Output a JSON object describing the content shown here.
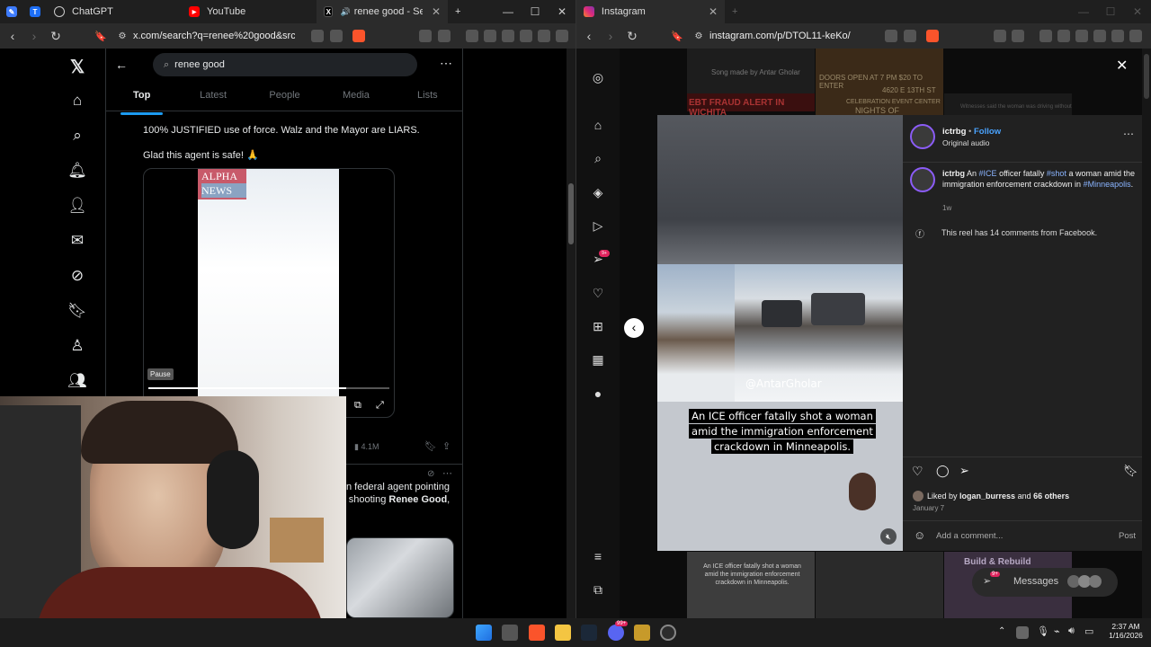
{
  "left_browser": {
    "tabs": [
      {
        "label": "ChatGPT"
      },
      {
        "label": "YouTube"
      },
      {
        "label": "renee good - Search / X",
        "active": true
      }
    ],
    "url": "x.com/search?q=renee%20good&src=typ..."
  },
  "x": {
    "search_value": "renee good",
    "tabs": [
      "Top",
      "Latest",
      "People",
      "Media",
      "Lists"
    ],
    "post1_text": "100% JUSTIFIED use of force. Walz and the Mayor are LIARS.",
    "post2_text": "Glad this agent is safe! 🙏",
    "video_logo_line1": "ALPHA",
    "video_logo_line2": "NEWS",
    "video_pause_label": "Pause",
    "views": "4.1M",
    "next_post_text1": "n federal agent pointing",
    "next_post_text2": "r shooting ",
    "next_post_bold": "Renee Good",
    "next_post_comma": ","
  },
  "right_browser": {
    "tab_label": "Instagram",
    "url": "instagram.com/p/DTOL11-keKo/"
  },
  "instagram": {
    "username": "ictrbg",
    "follow": "Follow",
    "audio": "Original audio",
    "caption_user": "ictrbg",
    "caption_prefix": "An ",
    "caption_tag1": "#ICE",
    "caption_mid1": " officer fatally ",
    "caption_tag2": "#shot",
    "caption_mid2": " a woman amid the immigration enforcement crackdown in ",
    "caption_tag3": "#Minneapolis",
    "caption_end": ".",
    "caption_age": "1w",
    "facebook_note": "This reel has 14 comments from Facebook.",
    "liked_by_prefix": "Liked by ",
    "liked_by_user": "logan_burress",
    "liked_by_and": " and ",
    "liked_by_others": "66 others",
    "date": "January 7",
    "comment_placeholder": "Add a comment...",
    "post_button": "Post",
    "video_watermark": "@AntarGholar",
    "video_caption": "An ICE officer fatally shot a woman amid the immigration enforcement crackdown in Minneapolis.",
    "bg_text_song": "Song made by Antar Gholar",
    "bg_text_ebt": "EBT FRAUD ALERT IN WICHITA",
    "bg_text_doors": "DOORS OPEN AT 7 PM $20 TO ENTER",
    "bg_text_addr": "4620 E 13TH ST",
    "bg_text_celebration": "CELEBRATION EVENT CENTER",
    "bg_text_nights": "NIGHTS OF",
    "bg_text_witness": "Witnesses said the woman was driving without",
    "bg_text_bottom_caption": "An ICE officer fatally shot a woman amid the immigration enforcement crackdown in Minneapolis.",
    "bg_text_build": "Build & Rebuild",
    "messages_label": "Messages",
    "messages_badge": "9+",
    "notification_badge": "9+"
  },
  "taskbar": {
    "time": "2:37 AM",
    "date": "1/16/2026",
    "discord_badge": "99+"
  },
  "colors": {
    "x_accent": "#1d9bf0",
    "ig_link": "#e0f1ff",
    "ig_hashtag": "#8ab4ff",
    "notify_red": "#e0245e"
  }
}
